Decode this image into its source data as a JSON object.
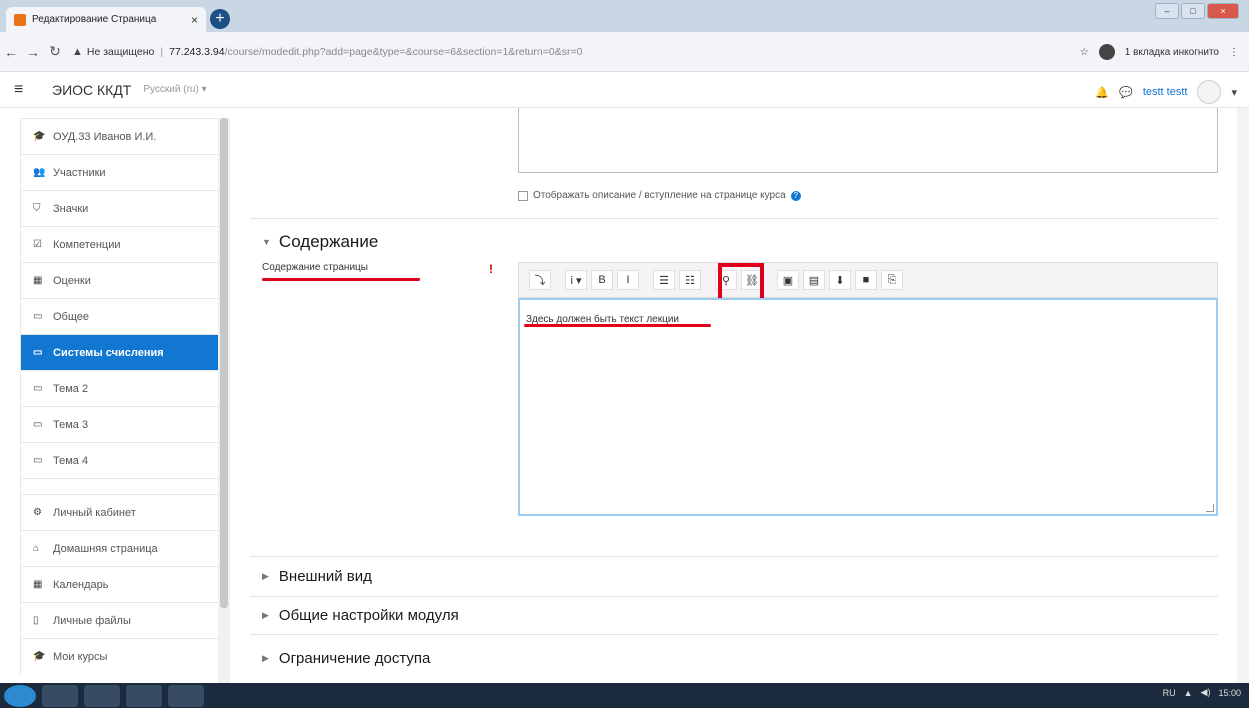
{
  "browser": {
    "tab_title": "Редактирование Страница",
    "tab_close": "×",
    "new_tab": "+",
    "warning_icon": "▲",
    "not_secure": "Не защищено",
    "url_host": "77.243.3.94",
    "url_path": "/course/modedit.php?add=page&type=&course=6&section=1&return=0&sr=0",
    "incognito": "1 вкладка инкогнито"
  },
  "header": {
    "brand": "ЭИОС ККДТ",
    "lang": "Русский (ru) ▾",
    "user_name": "testt testt"
  },
  "sidebar": {
    "items": [
      {
        "icon": "🎓",
        "label": "ОУД.33 Иванов И.И."
      },
      {
        "icon": "👥",
        "label": "Участники"
      },
      {
        "icon": "⛉",
        "label": "Значки"
      },
      {
        "icon": "☑",
        "label": "Компетенции"
      },
      {
        "icon": "▦",
        "label": "Оценки"
      },
      {
        "icon": "▭",
        "label": "Общее"
      },
      {
        "icon": "▭",
        "label": "Системы счисления"
      },
      {
        "icon": "▭",
        "label": "Тема 2"
      },
      {
        "icon": "▭",
        "label": "Тема 3"
      },
      {
        "icon": "▭",
        "label": "Тема 4"
      }
    ],
    "items2": [
      {
        "icon": "⚙",
        "label": "Личный кабинет"
      },
      {
        "icon": "⌂",
        "label": "Домашняя страница"
      },
      {
        "icon": "▦",
        "label": "Календарь"
      },
      {
        "icon": "▯",
        "label": "Личные файлы"
      },
      {
        "icon": "🎓",
        "label": "Мои курсы"
      }
    ]
  },
  "main": {
    "show_description": "Отображать описание / вступление на странице курса",
    "section_title": "Содержание",
    "field_label": "Содержание страницы",
    "required_mark": "!",
    "editor_text": "Здесь должен быть текст лекции",
    "toolbar": [
      "⤵",
      "i ▾",
      "B",
      "I",
      "☰",
      "☷",
      "⚲",
      "⛓",
      "▣",
      "▤",
      "⬇",
      "■",
      "⎘"
    ],
    "collapsed_sections": [
      "Внешний вид",
      "Общие настройки модуля",
      "Ограничение доступа"
    ]
  },
  "tray": {
    "lang": "RU",
    "time": "15:00"
  }
}
